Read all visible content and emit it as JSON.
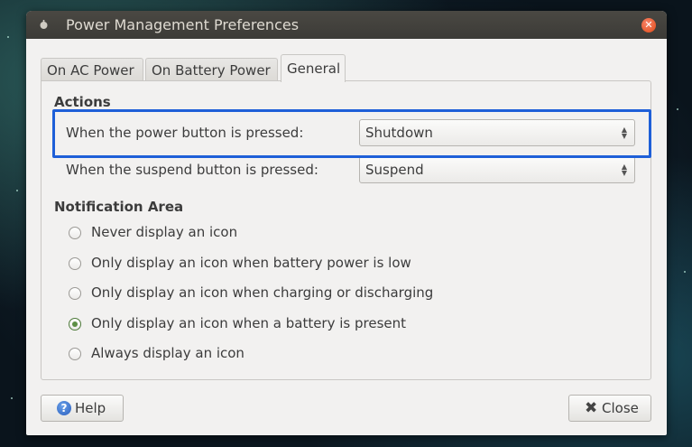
{
  "window": {
    "title": "Power Management Preferences"
  },
  "tabs": [
    {
      "label": "On AC Power"
    },
    {
      "label": "On Battery Power"
    },
    {
      "label": "General",
      "active": true
    }
  ],
  "actions": {
    "title": "Actions",
    "power_button_label": "When the power button is pressed:",
    "power_button_value": "Shutdown",
    "suspend_button_label": "When the suspend button is pressed:",
    "suspend_button_value": "Suspend"
  },
  "notification": {
    "title": "Notification Area",
    "options": [
      {
        "label": "Never display an icon",
        "checked": false
      },
      {
        "label": "Only display an icon when battery power is low",
        "checked": false
      },
      {
        "label": "Only display an icon when charging or discharging",
        "checked": false
      },
      {
        "label": "Only display an icon when a battery is present",
        "checked": true
      },
      {
        "label": "Always display an icon",
        "checked": false
      }
    ]
  },
  "footer": {
    "help_label": "Help",
    "close_label": "Close"
  },
  "colors": {
    "highlight": "#1e5fd8",
    "radio_checked": "#5c8f44",
    "close_button": "#df4a16"
  },
  "icons": {
    "title": "power-icon",
    "close": "close-icon",
    "help": "help-icon",
    "close_button": "x-icon"
  }
}
